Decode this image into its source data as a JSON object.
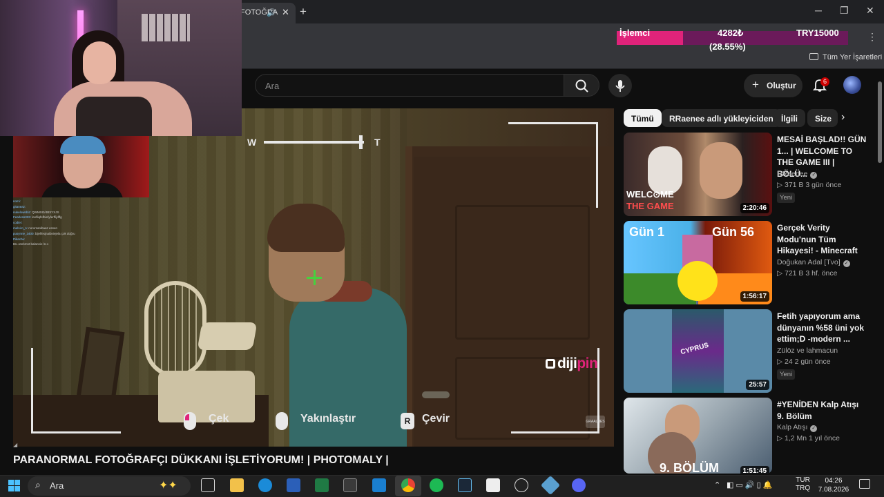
{
  "browser": {
    "tab_title": "FOTOĞRA",
    "tab_audio_icon": "speaker-icon",
    "bookmarks_all": "Tüm Yer İşaretleri"
  },
  "cpu_overlay": {
    "label": "İşlemci",
    "value": "4282₺",
    "percent_text": "(28.55%)",
    "fill_fraction": 0.2855,
    "price": "TRY15000",
    "bar_color": "#e0237a"
  },
  "youtube": {
    "search_placeholder": "Ara",
    "create_label": "Oluştur",
    "notification_count": "6"
  },
  "stream_chat": [
    {
      "user": "nomi",
      "msg": ""
    },
    {
      "user": "gitaneaz",
      "msg": ""
    },
    {
      "user": "nukelownbiz",
      "msg": "QWMSI3/4BSYXJS"
    },
    {
      "user": "Fearless333",
      "msg": "leefliqfefbiefyferffijdffg"
    },
    {
      "user": "codier",
      "msg": ""
    },
    {
      "user": "melniro_n",
      "msg": "nororsanibaaz essen"
    },
    {
      "user": "pusynne_3400",
      "msg": "bijelfesjnaibniejela çok doğru"
    },
    {
      "user": "",
      "msg": ""
    },
    {
      "user": "Pikachu",
      "msg": ""
    },
    {
      "user": "",
      "msg": "Bü..tanbmnt balannie lü o"
    }
  ],
  "game_hud": {
    "zoom_wide": "W",
    "zoom_tele": "T",
    "zoom_level": 0.95,
    "action_shoot": "Çek",
    "action_zoom": "Yakınlaştır",
    "action_rotate": "Çevir",
    "rotate_key": "R",
    "watermark_a": "diji",
    "watermark_b": "pin",
    "studio_logo": "GRAALNES"
  },
  "video": {
    "title": "PARANORMAL FOTOĞRAFÇI DÜKKANI İŞLETİYORUM! | PHOTOMALY |"
  },
  "filter_chips": [
    "Tümü",
    "RRaenee adlı yükleyiciden",
    "İlgili",
    "Size"
  ],
  "recommendations": [
    {
      "title": "MESAİ BAŞLAD!! GÜN 1...  | WELCOME TO THE GAME III | BÖLÜ...",
      "channel": "RRaenee",
      "verified": true,
      "meta": "▷ 371 B   3 gün önce",
      "badge": "Yeni",
      "duration": "2:20:46",
      "thumb_text_a": "WELC⊙ME",
      "thumb_text_b": "THE GAME"
    },
    {
      "title": "Gerçek Verity Modu'nun Tüm Hikayesi! - Minecraft",
      "channel": "Doğukan Adal [Tvo]",
      "verified": true,
      "meta": "▷ 721 B   3 hf. önce",
      "badge": "",
      "duration": "1:56:17",
      "thumb_text_a": "Gün 1",
      "thumb_text_b": "Gün 56"
    },
    {
      "title": "Fetih yapıyorum ama dünyanın %58 üni yok ettim;D -modern ...",
      "channel": "Zülöz ve lahmacun",
      "verified": false,
      "meta": "▷ 24   2 gün önce",
      "badge": "Yeni",
      "duration": "25:57",
      "thumb_text_a": "CYPRUS",
      "thumb_text_b": ""
    },
    {
      "title": "#YENİDEN Kalp Atışı 9. Bölüm",
      "channel": "Kalp Atışı",
      "verified": true,
      "meta": "▷ 1,2 Mn   1 yıl önce",
      "badge": "",
      "duration": "1:51:45",
      "thumb_text_a": "9. BÖLÜM",
      "thumb_text_b": ""
    }
  ],
  "taskbar": {
    "search_label": "Ara",
    "lang_a": "TUR",
    "lang_b": "TRQ",
    "time": "04:26",
    "date": "7.08.2026"
  }
}
